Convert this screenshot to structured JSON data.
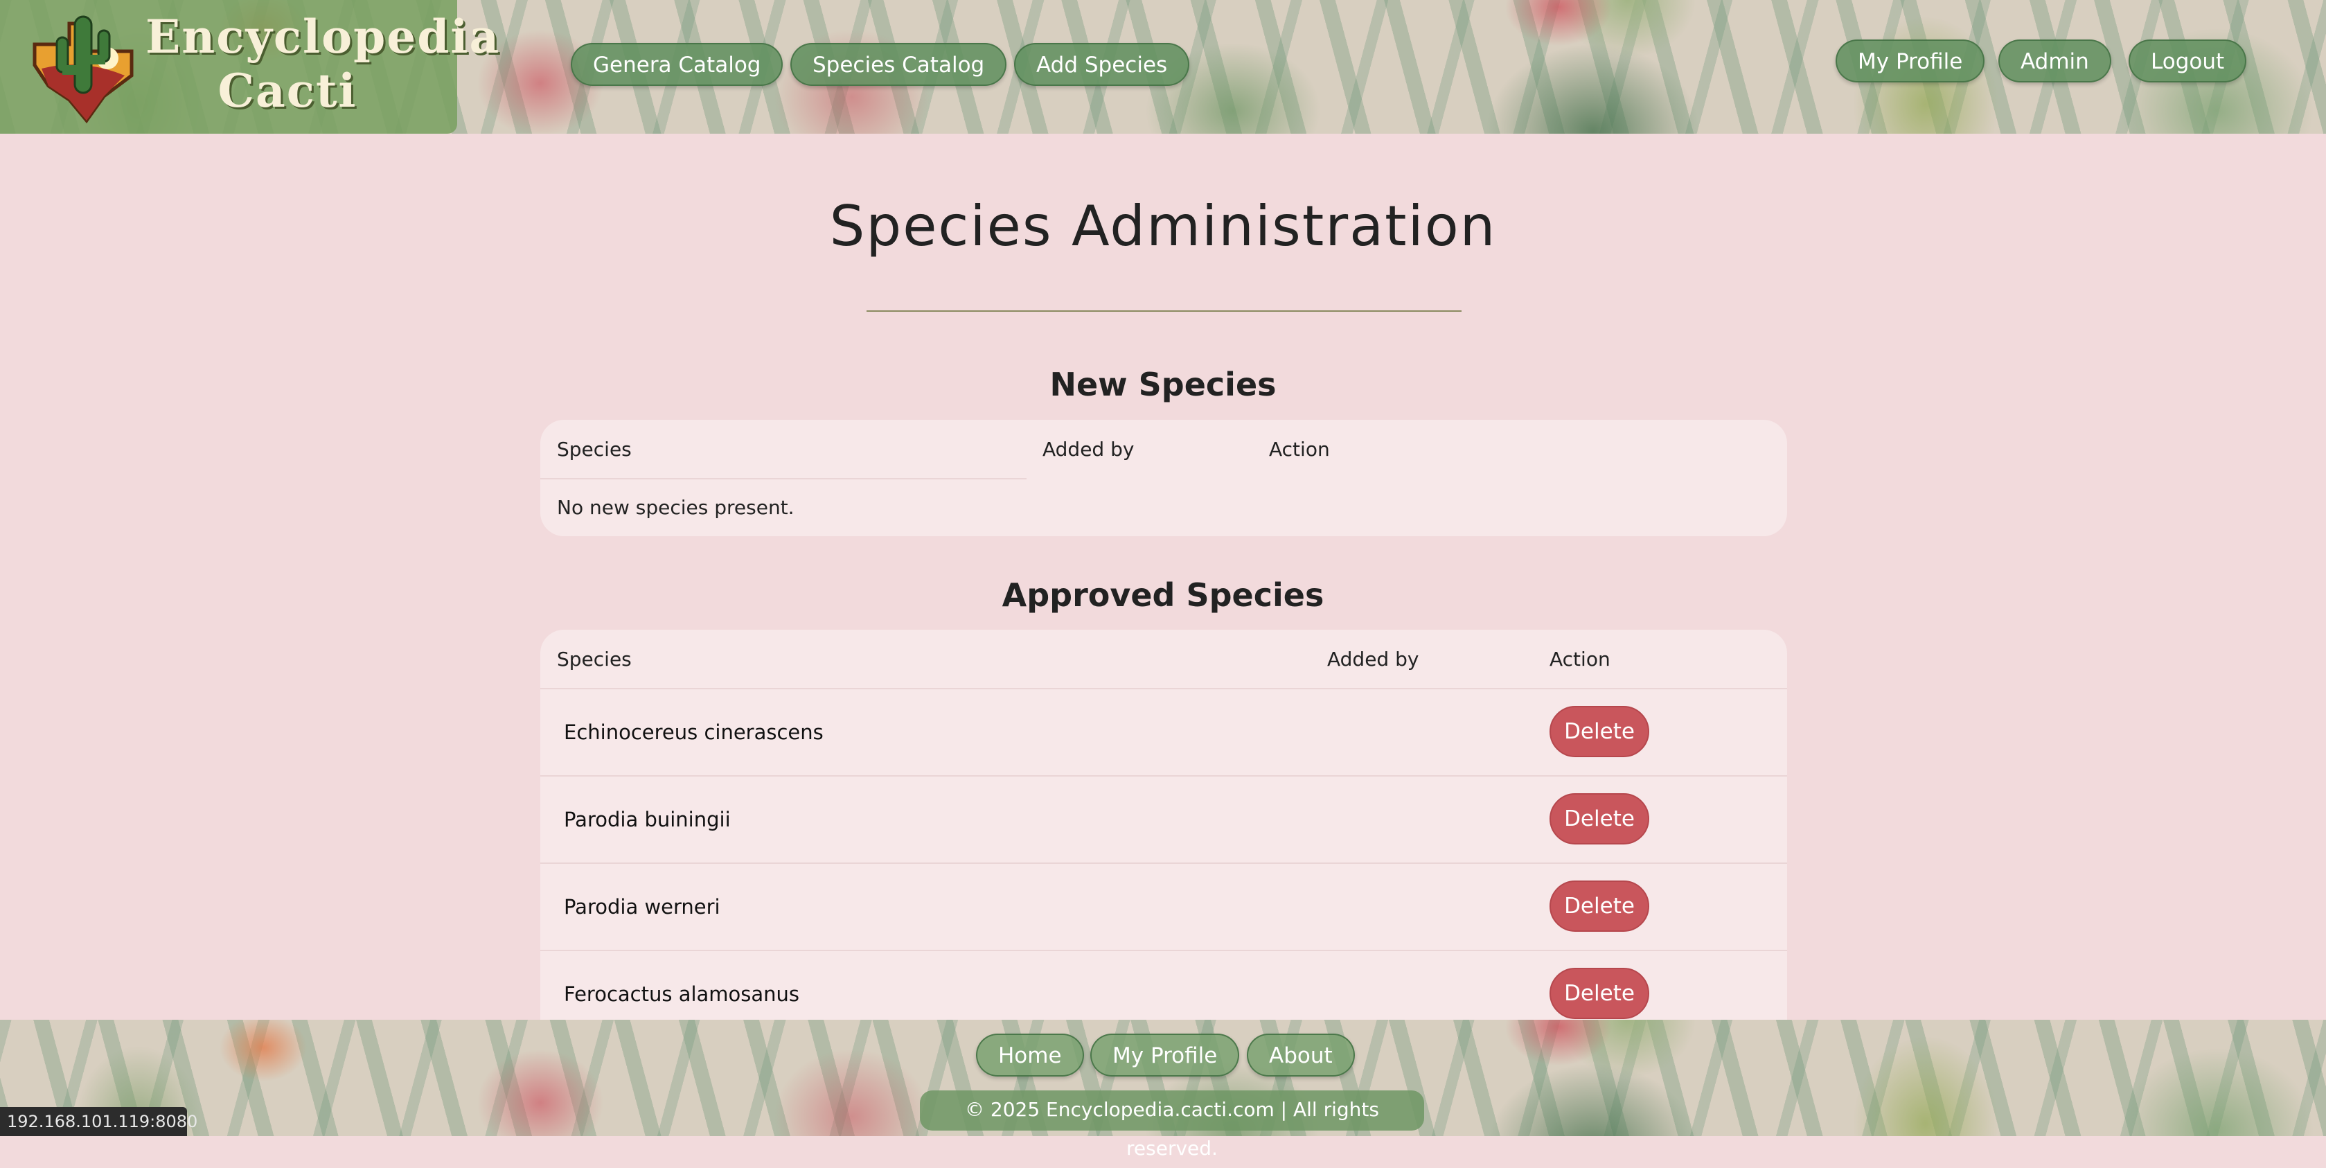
{
  "brand": {
    "line1": "Encyclopedia",
    "line2": "Cacti"
  },
  "nav": {
    "left": [
      "Genera Catalog",
      "Species Catalog",
      "Add Species"
    ],
    "right": [
      "My Profile",
      "Admin",
      "Logout"
    ]
  },
  "page": {
    "title": "Species Administration"
  },
  "new_species": {
    "heading": "New Species",
    "columns": [
      "Species",
      "Added by",
      "Action"
    ],
    "empty_message": "No new species present."
  },
  "approved_species": {
    "heading": "Approved Species",
    "columns": [
      "Species",
      "Added by",
      "Action"
    ],
    "rows": [
      {
        "species": "Echinocereus cinerascens",
        "added_by": "",
        "action": "Delete"
      },
      {
        "species": "Parodia buiningii",
        "added_by": "",
        "action": "Delete"
      },
      {
        "species": "Parodia werneri",
        "added_by": "",
        "action": "Delete"
      },
      {
        "species": "Ferocactus alamosanus",
        "added_by": "",
        "action": "Delete"
      }
    ]
  },
  "footer": {
    "links": [
      "Home",
      "My Profile",
      "About"
    ],
    "copyright": "© 2025 Encyclopedia.cacti.com | All rights reserved."
  },
  "status_bar": {
    "url": "192.168.101.119:8080"
  },
  "colors": {
    "background": "#f2dadc",
    "card": "#f7e8e9",
    "pill": "#629160",
    "delete": "#c9565c"
  }
}
